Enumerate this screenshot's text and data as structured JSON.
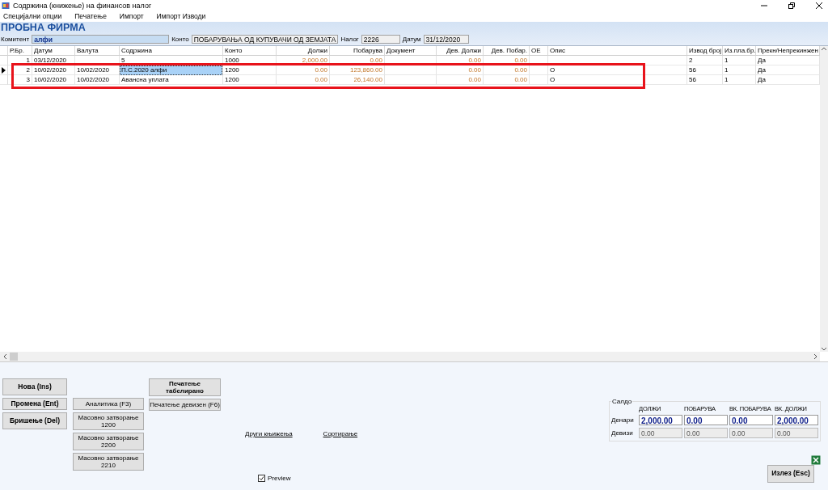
{
  "window": {
    "title": "Содржина (книжење) на финансов налог"
  },
  "menu": [
    "Специјални опции",
    "Печатење",
    "Импорт",
    "Импорт Изводи"
  ],
  "company": "ПРОБНА ФИРМА",
  "filter": [
    {
      "label": "Комитент",
      "value": "алфи",
      "kind": "highlight"
    },
    {
      "label": "Конто",
      "value": "ПОБАРУВАЊА ОД КУПУВАЧИ ОД ЗЕМЈАТА",
      "kind": "plain"
    },
    {
      "label": "Налог",
      "value": "2226",
      "kind": "plain"
    },
    {
      "label": "Датум",
      "value": "31/12/2020",
      "kind": "plain"
    }
  ],
  "table": {
    "columns": [
      {
        "label": "Р.Бр.",
        "kind": "number"
      },
      {
        "label": "Датум",
        "kind": "text"
      },
      {
        "label": "Валута",
        "kind": "text"
      },
      {
        "label": "Содржина",
        "kind": "text"
      },
      {
        "label": "Конто",
        "kind": "text"
      },
      {
        "label": "Должи",
        "kind": "amount"
      },
      {
        "label": "Побарува",
        "kind": "amount"
      },
      {
        "label": "Документ",
        "kind": "text"
      },
      {
        "label": "Дев. Должи",
        "kind": "amount"
      },
      {
        "label": "Дев. Побар.",
        "kind": "amount"
      },
      {
        "label": "ОЕ",
        "kind": "text"
      },
      {
        "label": "Опис",
        "kind": "text"
      },
      {
        "label": "Извод број",
        "kind": "text"
      },
      {
        "label": "Из.пла.бр.",
        "kind": "text"
      },
      {
        "label": "Прекн/Непрекинжен",
        "kind": "text"
      }
    ],
    "rows": [
      {
        "selected": false,
        "cells": [
          "1",
          "03/12/2020",
          "",
          "5",
          "1000",
          "2,000.00",
          "0.00",
          "",
          "0.00",
          "0.00",
          "",
          "",
          "2",
          "1",
          "Да"
        ]
      },
      {
        "selected": true,
        "cells": [
          "2",
          "10/02/2020",
          "10/02/2020",
          "П.С.2020 алфи",
          "1200",
          "0.00",
          "123,860.00",
          "",
          "0.00",
          "0.00",
          "",
          "О",
          "56",
          "1",
          "Да"
        ]
      },
      {
        "selected": false,
        "cells": [
          "3",
          "10/02/2020",
          "10/02/2020",
          "Авансна уплата",
          "1200",
          "0.00",
          "26,140.00",
          "",
          "0.00",
          "0.00",
          "",
          "О",
          "56",
          "1",
          "Да"
        ]
      }
    ]
  },
  "actions": [
    {
      "kind": "bold",
      "buttons": [
        "Нова (Ins)",
        "Промена (Ent)",
        "Бришење (Del)"
      ]
    },
    {
      "kind": "normal",
      "buttons": [
        "Аналитика (F3)",
        "Масовно затворање\n1200",
        "Масовно затворање\n2200",
        "Масовно затворање\n2210"
      ]
    },
    {
      "kind": "print",
      "buttons": [
        "Печатење\nтабелирано",
        "Печатење девизен (F6)"
      ]
    }
  ],
  "links": [
    "Други књижења",
    "Сортирање"
  ],
  "preview": {
    "label": "Preview",
    "checked": true
  },
  "saldo": {
    "title": "Салдо",
    "columns": [
      "ДОЛЖИ",
      "ПОБАРУВА",
      "ВК. ПОБАРУВА",
      "ВК. ДОЛЖИ"
    ],
    "rows": [
      {
        "label": "Денари",
        "disabled": false,
        "values": [
          "2,000.00",
          "0.00",
          "0.00",
          "2,000.00"
        ]
      },
      {
        "label": "Девизи",
        "disabled": true,
        "values": [
          "0.00",
          "0.00",
          "0.00",
          "0.00"
        ]
      }
    ]
  },
  "exit_button": "Излез (Esc)"
}
